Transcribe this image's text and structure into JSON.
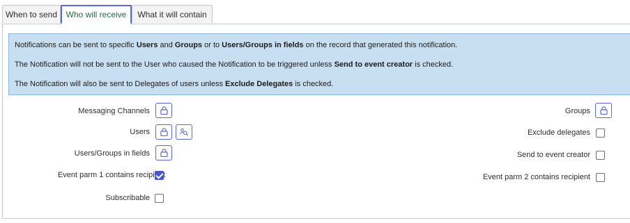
{
  "tabs": [
    {
      "label": "When to send",
      "active": false
    },
    {
      "label": "Who will receive",
      "active": true
    },
    {
      "label": "What it will contain",
      "active": false
    }
  ],
  "info": {
    "line1": {
      "t1": "Notifications can be sent to specific ",
      "b1": "Users",
      "t2": " and ",
      "b2": "Groups",
      "t3": " or to ",
      "b3": "Users/Groups in fields",
      "t4": " on the record that generated this notification."
    },
    "line2": {
      "t1": "The Notification will not be sent to the User who caused the Notification to be triggered unless ",
      "b1": "Send to event creator",
      "t2": " is checked."
    },
    "line3": {
      "t1": "The Notification will also be sent to Delegates of users unless ",
      "b1": "Exclude Delegates",
      "t2": " is checked."
    }
  },
  "fields": {
    "messaging_channels": "Messaging Channels",
    "users": "Users",
    "users_groups_in_fields": "Users/Groups in fields",
    "event_parm1": {
      "label": "Event parm 1 contains recipient",
      "checked": true
    },
    "subscribable": {
      "label": "Subscribable",
      "checked": false
    },
    "groups": "Groups",
    "exclude_delegates": {
      "label": "Exclude delegates",
      "checked": false
    },
    "send_to_event_creator": {
      "label": "Send to event creator",
      "checked": false
    },
    "event_parm2": {
      "label": "Event parm 2 contains recipient",
      "checked": false
    }
  },
  "colors": {
    "accent": "#5b6ad8",
    "info_bg": "#c7dff0",
    "active_tab_text": "#1f6b48"
  },
  "icons": {
    "lock": "lock-icon",
    "groups_lookup": "group-lookup-icon"
  }
}
